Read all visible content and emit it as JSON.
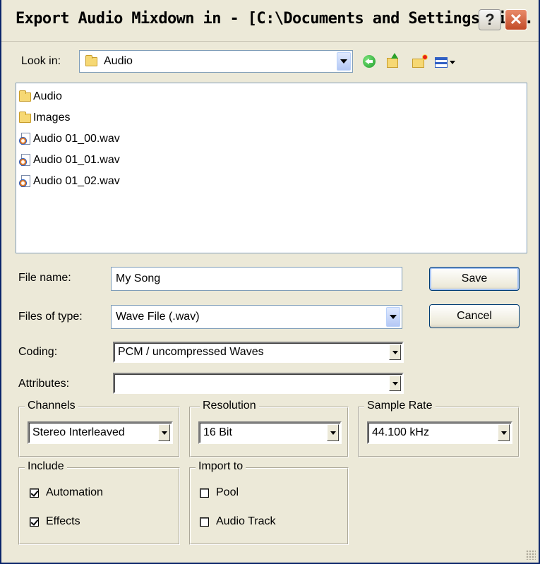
{
  "window": {
    "title": "Export Audio Mixdown in - [C:\\Documents and Settings\\ri...",
    "help_label": "?",
    "close_label": "✕"
  },
  "look_in": {
    "label": "Look in:",
    "value": "Audio"
  },
  "toolbar": {
    "back_icon": "back-icon",
    "up_icon": "up-folder-icon",
    "new_folder_icon": "new-folder-icon",
    "views_icon": "views-menu-icon"
  },
  "files": [
    {
      "name": "Audio",
      "icon": "folder-icon"
    },
    {
      "name": "Images",
      "icon": "folder-icon"
    },
    {
      "name": "Audio 01_00.wav",
      "icon": "wav-file-icon"
    },
    {
      "name": "Audio 01_01.wav",
      "icon": "wav-file-icon"
    },
    {
      "name": "Audio 01_02.wav",
      "icon": "wav-file-icon"
    }
  ],
  "file_name": {
    "label": "File name:",
    "value": "My Song"
  },
  "file_type": {
    "label": "Files of type:",
    "value": "Wave File (.wav)"
  },
  "buttons": {
    "save": "Save",
    "cancel": "Cancel"
  },
  "coding": {
    "label": "Coding:",
    "value": "PCM / uncompressed Waves"
  },
  "attributes": {
    "label": "Attributes:",
    "value": ""
  },
  "channels": {
    "title": "Channels",
    "value": "Stereo Interleaved"
  },
  "resolution": {
    "title": "Resolution",
    "value": "16 Bit"
  },
  "sample_rate": {
    "title": "Sample Rate",
    "value": "44.100 kHz"
  },
  "include": {
    "title": "Include",
    "automation": {
      "label": "Automation",
      "checked": true
    },
    "effects": {
      "label": "Effects",
      "checked": true
    }
  },
  "import_to": {
    "title": "Import to",
    "pool": {
      "label": "Pool",
      "checked": false
    },
    "audio_track": {
      "label": "Audio Track",
      "checked": false
    }
  }
}
